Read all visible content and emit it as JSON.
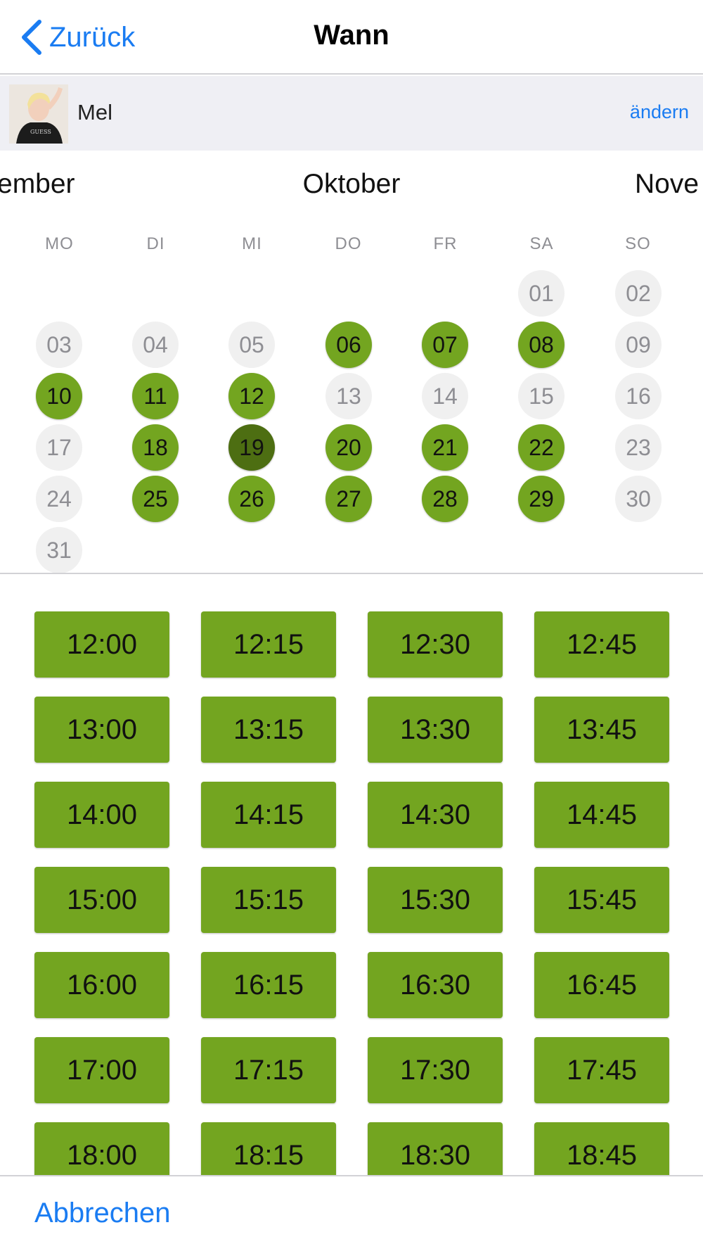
{
  "navbar": {
    "back_label": "Zurück",
    "title": "Wann"
  },
  "person": {
    "name": "Mel",
    "change_label": "ändern",
    "avatar_logo_text": "GUESS"
  },
  "calendar": {
    "prev_month_partial": "ember",
    "current_month": "Oktober",
    "next_month_partial": "Nove",
    "weekdays": [
      "MO",
      "DI",
      "MI",
      "DO",
      "FR",
      "SA",
      "SO"
    ],
    "weeks": [
      [
        null,
        null,
        null,
        null,
        null,
        {
          "label": "01",
          "status": "unavailable"
        },
        {
          "label": "02",
          "status": "unavailable"
        }
      ],
      [
        {
          "label": "03",
          "status": "unavailable"
        },
        {
          "label": "04",
          "status": "unavailable"
        },
        {
          "label": "05",
          "status": "unavailable"
        },
        {
          "label": "06",
          "status": "available"
        },
        {
          "label": "07",
          "status": "available"
        },
        {
          "label": "08",
          "status": "available"
        },
        {
          "label": "09",
          "status": "unavailable"
        }
      ],
      [
        {
          "label": "10",
          "status": "available"
        },
        {
          "label": "11",
          "status": "available"
        },
        {
          "label": "12",
          "status": "available"
        },
        {
          "label": "13",
          "status": "unavailable"
        },
        {
          "label": "14",
          "status": "unavailable"
        },
        {
          "label": "15",
          "status": "unavailable"
        },
        {
          "label": "16",
          "status": "unavailable"
        }
      ],
      [
        {
          "label": "17",
          "status": "unavailable"
        },
        {
          "label": "18",
          "status": "available"
        },
        {
          "label": "19",
          "status": "selected"
        },
        {
          "label": "20",
          "status": "available"
        },
        {
          "label": "21",
          "status": "available"
        },
        {
          "label": "22",
          "status": "available"
        },
        {
          "label": "23",
          "status": "unavailable"
        }
      ],
      [
        {
          "label": "24",
          "status": "unavailable"
        },
        {
          "label": "25",
          "status": "available"
        },
        {
          "label": "26",
          "status": "available"
        },
        {
          "label": "27",
          "status": "available"
        },
        {
          "label": "28",
          "status": "available"
        },
        {
          "label": "29",
          "status": "available"
        },
        {
          "label": "30",
          "status": "unavailable"
        }
      ],
      [
        {
          "label": "31",
          "status": "unavailable"
        },
        null,
        null,
        null,
        null,
        null,
        null
      ]
    ]
  },
  "time_slots": [
    [
      "12:00",
      "12:15",
      "12:30",
      "12:45"
    ],
    [
      "13:00",
      "13:15",
      "13:30",
      "13:45"
    ],
    [
      "14:00",
      "14:15",
      "14:30",
      "14:45"
    ],
    [
      "15:00",
      "15:15",
      "15:30",
      "15:45"
    ],
    [
      "16:00",
      "16:15",
      "16:30",
      "16:45"
    ],
    [
      "17:00",
      "17:15",
      "17:30",
      "17:45"
    ],
    [
      "18:00",
      "18:15",
      "18:30",
      "18:45"
    ]
  ],
  "footer": {
    "cancel_label": "Abbrechen"
  },
  "colors": {
    "accent_blue": "#1a7cf2",
    "available_green": "#73a520",
    "selected_green": "#4d6e12",
    "unavailable_gray": "#f0f0f0"
  }
}
